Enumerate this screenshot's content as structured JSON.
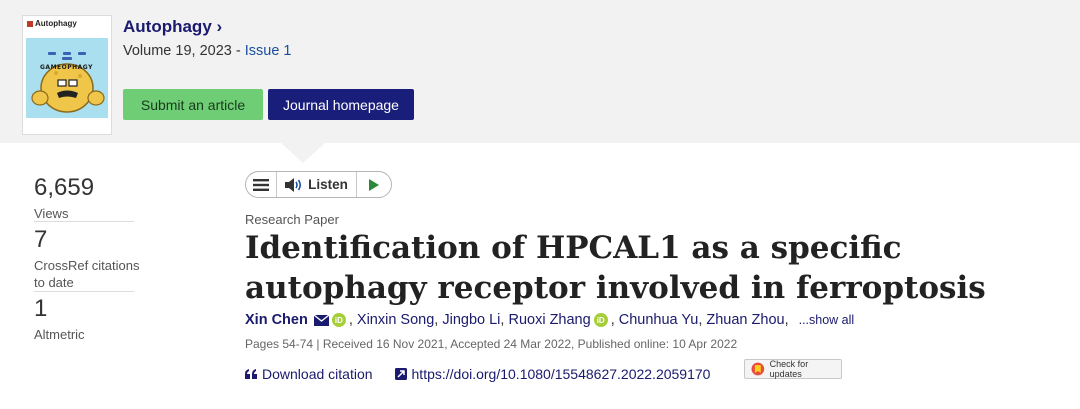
{
  "journal": {
    "name": "Autophagy",
    "name_arrow": "›",
    "volume_text": "Volume 19, 2023 - ",
    "issue_text": "Issue 1",
    "submit_label": "Submit an article",
    "homepage_label": "Journal homepage",
    "cover": {
      "title": "Autophagy",
      "subtitle": "GAMEOPHAGY"
    }
  },
  "metrics": [
    {
      "value": "6,659",
      "label": "Views"
    },
    {
      "value": "7",
      "label": "CrossRef citations to date"
    },
    {
      "value": "1",
      "label": "Altmetric"
    }
  ],
  "listen": {
    "label": "Listen"
  },
  "article": {
    "type": "Research Paper",
    "title": "Identification of HPCAL1 as a specific autophagy receptor involved in ferroptosis",
    "authors": [
      "Xin Chen",
      "Xinxin Song",
      "Jingbo Li",
      "Ruoxi Zhang",
      "Chunhua Yu",
      "Zhuan Zhou"
    ],
    "show_all": "...show all",
    "meta": "Pages 54-74 | Received 16 Nov 2021, Accepted 24 Mar 2022, Published online: 10 Apr 2022",
    "download_citation": "Download citation",
    "doi": "https://doi.org/10.1080/15548627.2022.2059170",
    "check_updates": "Check for updates"
  },
  "colors": {
    "brand_navy": "#1a1e7b",
    "submit_green": "#6fcd75",
    "orcid_green": "#a6ce39"
  }
}
